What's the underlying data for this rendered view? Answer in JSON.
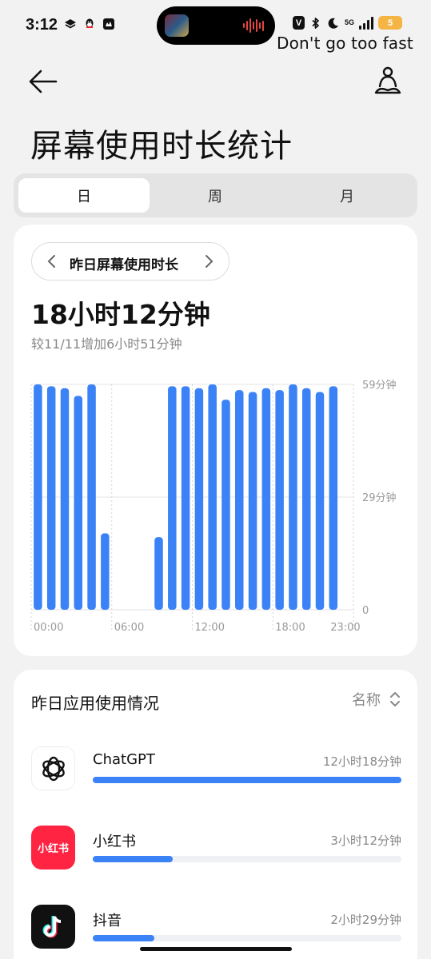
{
  "status_bar": {
    "time": "3:12",
    "network_label": "5G",
    "battery_level": "5",
    "overlay_text": "Don't go too fast"
  },
  "header": {
    "title": "屏幕使用时长统计"
  },
  "segments": [
    {
      "label": "日",
      "active": true
    },
    {
      "label": "周",
      "active": false
    },
    {
      "label": "月",
      "active": false
    }
  ],
  "summary": {
    "period_label": "昨日屏幕使用时长",
    "total": "18小时12分钟",
    "comparison": "较11/11增加6小时51分钟"
  },
  "chart_data": {
    "type": "bar",
    "categories": [
      "0",
      "1",
      "2",
      "3",
      "4",
      "5",
      "6",
      "7",
      "8",
      "9",
      "10",
      "11",
      "12",
      "13",
      "14",
      "15",
      "16",
      "17",
      "18",
      "19",
      "20",
      "21",
      "22",
      "23"
    ],
    "values": [
      59,
      58.5,
      58,
      56,
      59,
      20,
      0,
      0,
      0,
      19,
      58.5,
      58.5,
      58,
      59,
      55,
      57.5,
      57,
      58,
      57.5,
      59,
      58,
      57,
      58.5
    ],
    "values_note_unused": null,
    "x_tick_labels": [
      "00:00",
      "06:00",
      "12:00",
      "18:00",
      "23:00"
    ],
    "y_tick_labels": [
      "59分钟",
      "29分钟",
      "0"
    ],
    "ylim": [
      0,
      59
    ],
    "bar_color": "#3a82f6"
  },
  "apps": {
    "title": "昨日应用使用情况",
    "sort_label": "名称",
    "items": [
      {
        "name": "ChatGPT",
        "duration": "12小时18分钟",
        "fraction": 1.0,
        "icon": "chatgpt-icon"
      },
      {
        "name": "小红书",
        "duration": "3小时12分钟",
        "fraction": 0.26,
        "icon": "xiaohongshu-icon",
        "icon_text": "小红书"
      },
      {
        "name": "抖音",
        "duration": "2小时29分钟",
        "fraction": 0.2,
        "icon": "douyin-icon"
      }
    ]
  },
  "colors": {
    "accent": "#3a82f6",
    "xiaohongshu": "#ff2442",
    "battery": "#f5b544"
  }
}
